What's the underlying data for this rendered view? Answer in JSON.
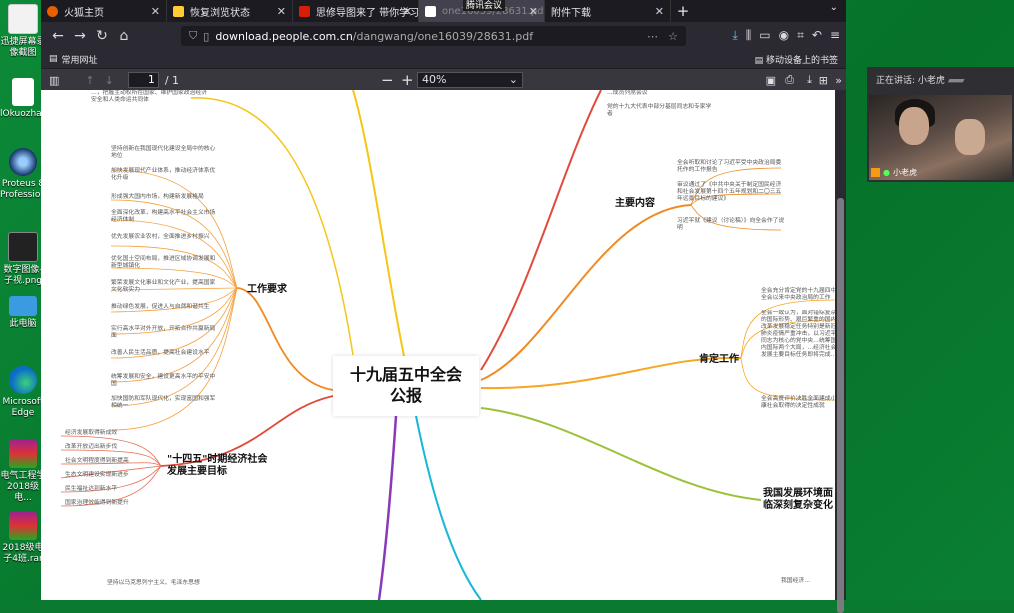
{
  "desktop": {
    "icons": [
      {
        "label": "迅捷屏幕录像截图"
      },
      {
        "label": "lOkuozhan..."
      },
      {
        "label": "Proteus 8 Professio..."
      },
      {
        "label": "数字图像-子视.png"
      },
      {
        "label": "此电脑"
      },
      {
        "label": "Microsoft Edge"
      },
      {
        "label": "电气工程学 2018级电..."
      },
      {
        "label": "2018级电子4班.rar"
      }
    ]
  },
  "browser": {
    "tabs": [
      {
        "label": "火狐主页",
        "color": "#e66000"
      },
      {
        "label": "恢复浏览状态",
        "color": "#ffcc33"
      },
      {
        "label": "思修导图来了 带你学习十…",
        "color": "#d81e06"
      },
      {
        "label": "one16039/28631.pdf",
        "color": "#ffffff"
      },
      {
        "label": "附件下载",
        "color": "#555555"
      }
    ],
    "meeting_popup_label": "腾讯会议",
    "url_host": "download.people.com.cn",
    "url_path": "/dangwang/one16039/28631.pdf",
    "bookmark_label": "常用网址",
    "mobile_bookmarks": "移动设备上的书签",
    "pdf": {
      "page_value": "1",
      "page_total": "/ 1",
      "zoom": "40%"
    }
  },
  "mindmap": {
    "center": [
      "十九届五中全会",
      "公报"
    ],
    "topics": {
      "work_requirements": "工作要求",
      "main_content": "主要内容",
      "affirmed_work": "肯定工作",
      "goals": "\"十四五\"时期经济社会发展主要目标",
      "environment": "我国发展环境面临深刻复杂变化"
    },
    "top_left_leaf": "…，把握主动权所在国家、维护国家政治经济安全和人类命运共同体",
    "work_leaves": [
      "坚持创新在我国现代化建设全局中的核心地位",
      "加快发展现代产业体系，推动经济体系优化升级",
      "形成强大国内市场，构建新发展格局",
      "全面深化改革，构建高水平社会主义市场经济体制",
      "优先发展农业农村，全面推进乡村振兴",
      "优化国土空间布局，推进区域协调发展和新型城镇化",
      "繁荣发展文化事业和文化产业，提高国家文化软实力",
      "推动绿色发展，促进人与自然和谐共生",
      "实行高水平对外开放，开拓合作共赢新局面",
      "改善人民生活品质，提高社会建设水平",
      "统筹发展和安全，建设更高水平的平安中国",
      "加快国防和军队现代化，实现富国和强军相统一"
    ],
    "goal_leaves": [
      "经济发展取得新成效",
      "改革开放迈出新步伐",
      "社会文明程度得到新提高",
      "生态文明建设实现新进步",
      "民生福祉达到新水平",
      "国家治理效能得到新提升"
    ],
    "bottom_leaf": "坚持以马克思列宁主义、毛泽东思想",
    "main_leaves": [
      "全会听取和讨论了习近平受中央政治局委托作的工作报告",
      "审议通过了《中共中央关于制定国民经济和社会发展第十四个五年规划和二〇三五年远景目标的建议》",
      "习近平就《建议（讨论稿）》向全会作了说明"
    ],
    "top_right_leaves": [
      "…成员列席会议",
      "党的十九大代表中部分基层同志和专家学者"
    ],
    "affirm_leaves": [
      "全会充分肯定党的十九届四中全会以来中央政治局的工作",
      "全会一致认为，面对错综复杂的国际形势、艰巨繁重的国内改革发展稳定任务特别是新冠肺炎疫情严重冲击，以习近平同志为核心的党中央…统筹国内国际两个大局，…经济社会发展主要目标任务即将完成…",
      "全会高度评价决胜全面建成小康社会取得的决定性成就"
    ],
    "bottom_right_leaf": "我国经济…"
  },
  "meeting": {
    "speaking_label": "正在讲话: 小老虎",
    "participant_name": "小老虎"
  }
}
